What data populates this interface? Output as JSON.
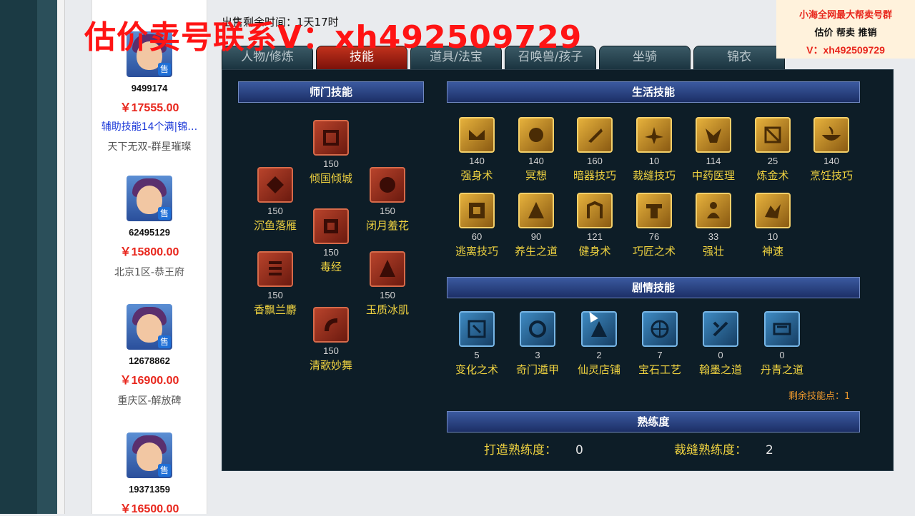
{
  "watermark": "估价卖号联系V：xh492509729",
  "promo": {
    "line1": "小海全网最大帮卖号群",
    "line2": "估价 帮卖 推销",
    "line3": "V：xh492509729"
  },
  "header": {
    "timer_label": "出售剩余时间：",
    "timer_value": "1天17时"
  },
  "listings": [
    {
      "id": "9499174",
      "price": "￥17555.00",
      "skills": "辅助技能14个满|锦…",
      "server": "天下无双-群星璀璨",
      "sale": "售"
    },
    {
      "id": "62495129",
      "price": "￥15800.00",
      "skills": "",
      "server": "北京1区-恭王府",
      "sale": "售"
    },
    {
      "id": "12678862",
      "price": "￥16900.00",
      "skills": "",
      "server": "重庆区-解放碑",
      "sale": "售"
    },
    {
      "id": "19371359",
      "price": "￥16500.00",
      "skills": "",
      "server": "",
      "sale": "售"
    }
  ],
  "tabs": [
    "人物/修炼",
    "技能",
    "道具/法宝",
    "召唤兽/孩子",
    "坐骑",
    "锦衣"
  ],
  "sections": {
    "school": "师门技能",
    "life": "生活技能",
    "story": "剧情技能",
    "proficiency": "熟练度"
  },
  "school_skills": [
    {
      "name": "倾国倾城",
      "level": "150"
    },
    {
      "name": "沉鱼落雁",
      "level": "150"
    },
    {
      "name": "闭月羞花",
      "level": "150"
    },
    {
      "name": "毒经",
      "level": "150"
    },
    {
      "name": "香飘兰麝",
      "level": "150"
    },
    {
      "name": "玉质冰肌",
      "level": "150"
    },
    {
      "name": "清歌妙舞",
      "level": "150"
    }
  ],
  "life_skills": [
    {
      "name": "强身术",
      "level": "140"
    },
    {
      "name": "冥想",
      "level": "140"
    },
    {
      "name": "暗器技巧",
      "level": "160"
    },
    {
      "name": "裁缝技巧",
      "level": "10"
    },
    {
      "name": "中药医理",
      "level": "114"
    },
    {
      "name": "炼金术",
      "level": "25"
    },
    {
      "name": "烹饪技巧",
      "level": "140"
    },
    {
      "name": "逃离技巧",
      "level": "60"
    },
    {
      "name": "养生之道",
      "level": "90"
    },
    {
      "name": "健身术",
      "level": "121"
    },
    {
      "name": "巧匠之术",
      "level": "76"
    },
    {
      "name": "强壮",
      "level": "33"
    },
    {
      "name": "神速",
      "level": "10"
    }
  ],
  "story_skills": [
    {
      "name": "变化之术",
      "level": "5"
    },
    {
      "name": "奇门遁甲",
      "level": "3"
    },
    {
      "name": "仙灵店铺",
      "level": "2"
    },
    {
      "name": "宝石工艺",
      "level": "7"
    },
    {
      "name": "翰墨之道",
      "level": "0"
    },
    {
      "name": "丹青之道",
      "level": "0"
    }
  ],
  "remaining_points": "剩余技能点：1",
  "proficiency": {
    "forge_label": "打造熟练度：",
    "forge_value": "0",
    "tailor_label": "裁缝熟练度：",
    "tailor_value": "2"
  },
  "colors": {
    "accent_red": "#e8261c",
    "skill_text": "#f0d340",
    "panel_bg": "#0d1d27"
  }
}
